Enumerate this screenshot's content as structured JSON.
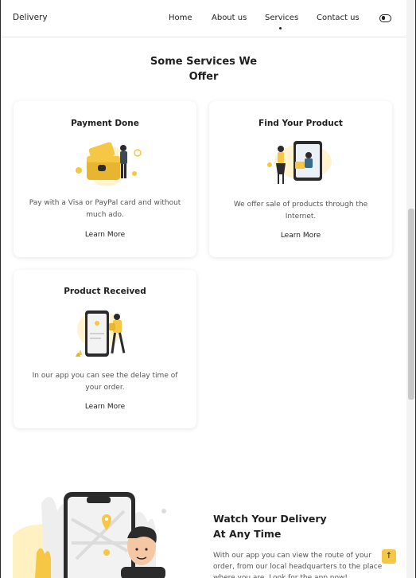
{
  "header": {
    "logo": "Delivery",
    "nav": [
      {
        "label": "Home"
      },
      {
        "label": "About us"
      },
      {
        "label": "Services",
        "active": true
      },
      {
        "label": "Contact us"
      }
    ],
    "theme_toggle_icon": "toggle-icon"
  },
  "services": {
    "title": "Some Services We Offer",
    "cards": [
      {
        "title": "Payment Done",
        "description": "Pay with a Visa or PayPal card and without much ado.",
        "link": "Learn More",
        "illustration": "wallet-payment-illustration"
      },
      {
        "title": "Find Your Product",
        "description": "We offer sale of products through the Internet.",
        "link": "Learn More",
        "illustration": "online-shopping-illustration"
      },
      {
        "title": "Product Received",
        "description": "In our app you can see the delay time of your order.",
        "link": "Learn More",
        "illustration": "delivery-phone-illustration"
      }
    ]
  },
  "watch": {
    "title_line1": "Watch Your Delivery",
    "title_line2": "At Any Time",
    "description": "With our app you can view the route of your order, from our local headquarters to the place where you are. Look for the app now!",
    "illustration": "map-phone-illustration"
  },
  "back_to_top": {
    "icon": "arrow-up-icon",
    "glyph": "↑"
  },
  "colors": {
    "accent": "#f6c744",
    "text": "#1f1f1f",
    "muted": "#555555"
  }
}
